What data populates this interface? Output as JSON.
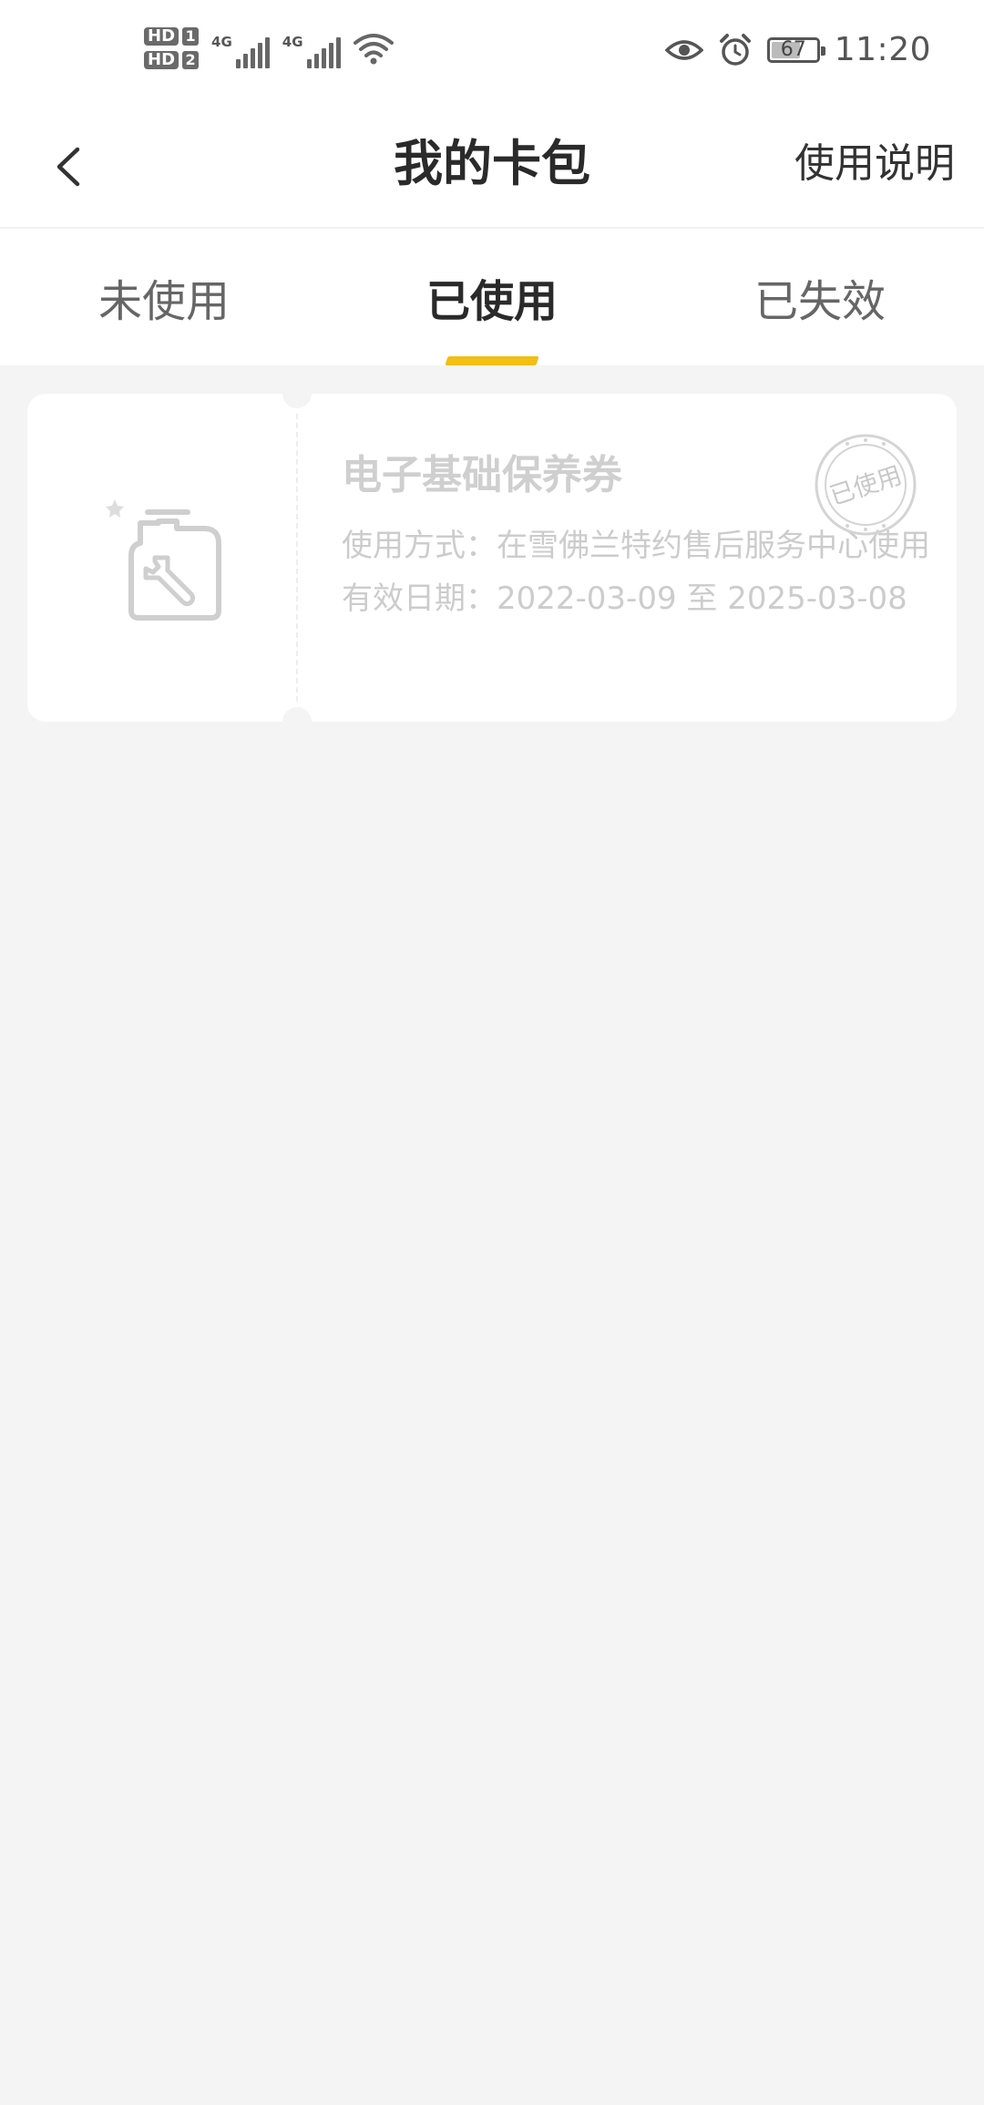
{
  "status_bar": {
    "hd1": "HD",
    "sim1": "1",
    "hd2": "HD",
    "sim2": "2",
    "net1": "4G",
    "net2": "4G",
    "battery": "67",
    "battery_level": 0.67,
    "time": "11:20",
    "icons": [
      "signal-icon",
      "wifi-icon",
      "eye-icon",
      "alarm-icon",
      "battery-icon"
    ]
  },
  "header": {
    "title": "我的卡包",
    "help_label": "使用说明"
  },
  "tabs": [
    {
      "label": "未使用",
      "active": false
    },
    {
      "label": "已使用",
      "active": true
    },
    {
      "label": "已失效",
      "active": false
    }
  ],
  "coupon": {
    "name": "电子基础保养券",
    "usage_label": "使用方式：",
    "usage": "在雪佛兰特约售后服务中心使用",
    "validity_label": "有效日期：",
    "validity": "2022-03-09 至 2025-03-08",
    "stamp_text": "已使用",
    "icon": "oil-can-wrench-icon"
  },
  "colors": {
    "accent": "#f2bf12",
    "background": "#f4f4f4",
    "card": "#ffffff",
    "disabled_text": "#cccccc"
  }
}
